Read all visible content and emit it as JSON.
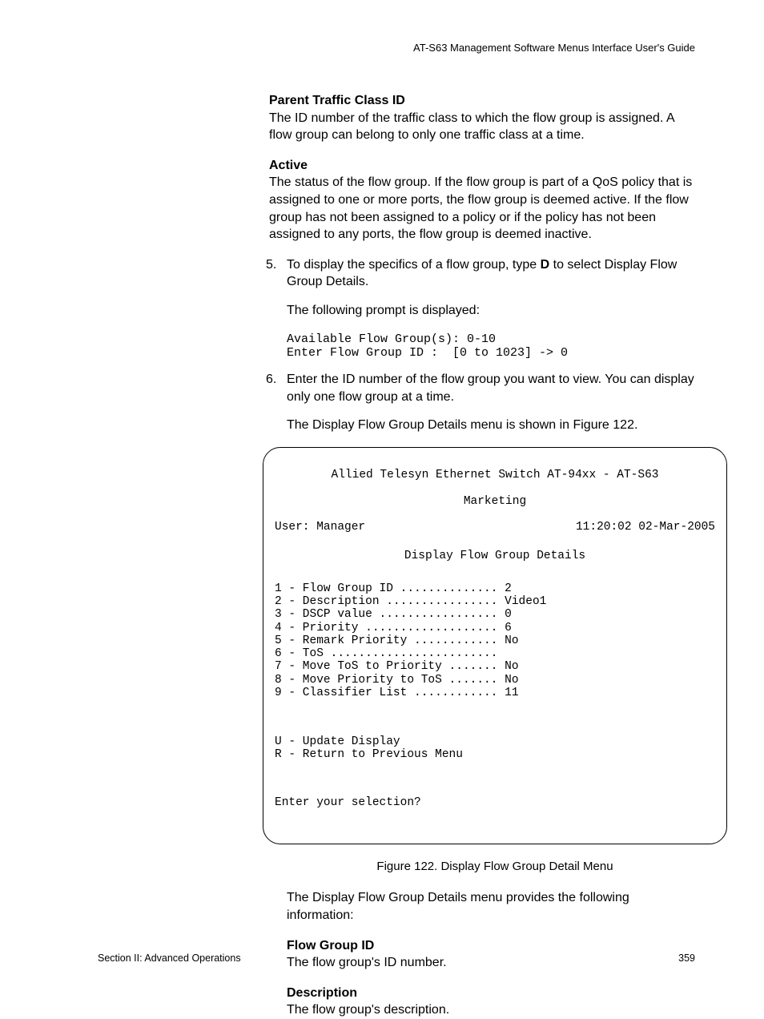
{
  "header": "AT-S63 Management Software Menus Interface User's Guide",
  "s1": {
    "title": "Parent Traffic Class ID",
    "body": "The ID number of the traffic class to which the flow group is assigned. A flow group can belong to only one traffic class at a time."
  },
  "s2": {
    "title": "Active",
    "body": "The status of the flow group. If the flow group is part of a QoS policy that is assigned to one or more ports, the flow group is deemed active. If the flow group has not been assigned to a policy or if the policy has not been assigned to any ports, the flow group is deemed inactive."
  },
  "step5": {
    "num": "5.",
    "t1": "To display the specifics of a flow group, type ",
    "bold": "D",
    "t2": " to select Display Flow Group Details.",
    "p2": "The following prompt is displayed:",
    "mono": "Available Flow Group(s): 0-10\nEnter Flow Group ID :  [0 to 1023] -> 0"
  },
  "step6": {
    "num": "6.",
    "t1": "Enter the ID number of the flow group you want to view. You can display only one flow group at a time.",
    "p2": "The Display Flow Group Details menu is shown in Figure 122."
  },
  "terminal": {
    "line1": "Allied Telesyn Ethernet Switch AT-94xx - AT-S63",
    "line2": "Marketing",
    "userL": "User: Manager",
    "userR": "11:20:02 02-Mar-2005",
    "title": "Display Flow Group Details",
    "items": "1 - Flow Group ID .............. 2\n2 - Description ................ Video1\n3 - DSCP value ................. 0\n4 - Priority ................... 6\n5 - Remark Priority ............ No\n6 - ToS ........................\n7 - Move ToS to Priority ....... No\n8 - Move Priority to ToS ....... No\n9 - Classifier List ............ 11",
    "cmds": "U - Update Display\nR - Return to Previous Menu",
    "prompt": "Enter your selection?"
  },
  "figcap": "Figure 122. Display Flow Group Detail Menu",
  "after": "The Display Flow Group Details menu provides the following information:",
  "s3": {
    "title": "Flow Group ID",
    "body": "The flow group's ID number."
  },
  "s4": {
    "title": "Description",
    "body": "The flow group's description."
  },
  "footer": {
    "left": "Section II: Advanced Operations",
    "right": "359"
  }
}
